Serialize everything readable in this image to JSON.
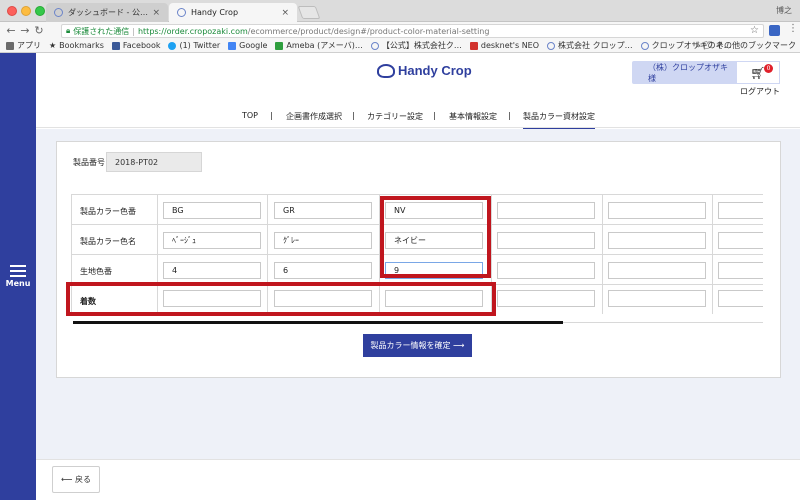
{
  "browser": {
    "tabs": [
      {
        "label": "ダッシュボード - 公式 | 株式会社",
        "active": false
      },
      {
        "label": "Handy Crop",
        "active": true
      }
    ],
    "profile_name": "博之",
    "secure_label": "保護された通信",
    "url_host": "https://order.cropozaki.com",
    "url_path": "/ecommerce/product/design#/product-color-material-setting",
    "bookmarks": [
      {
        "label": "アプリ",
        "icon": "apps-grid-icon"
      },
      {
        "label": "Bookmarks",
        "icon": "star-icon"
      },
      {
        "label": "Facebook",
        "icon": "facebook-icon"
      },
      {
        "label": "(1) Twitter",
        "icon": "twitter-icon"
      },
      {
        "label": "Google",
        "icon": "google-icon"
      },
      {
        "label": "Ameba (アメーバ)…",
        "icon": "ameba-icon"
      },
      {
        "label": "【公式】株式会社ク…",
        "icon": "globe-icon"
      },
      {
        "label": "desknet's NEO",
        "icon": "desknets-icon"
      },
      {
        "label": "株式会社 クロップ…",
        "icon": "globe-icon"
      },
      {
        "label": "クロップオザキのネ…",
        "icon": "globe-icon"
      }
    ],
    "other_bookmarks": "その他のブックマーク"
  },
  "rail": {
    "menu_label": "Menu"
  },
  "header": {
    "logo_text": "Handy Crop",
    "account_name": "（株）クロップオザキ 様",
    "cart_badge": "0",
    "logout_label": "ログアウト"
  },
  "nav": {
    "items": [
      "TOP",
      "企画書作成選択",
      "カテゴリー設定",
      "基本情報設定",
      "製品カラー資材設定"
    ],
    "active_index": 4
  },
  "form": {
    "product_number_label": "製品番号",
    "product_number_value": "2018-PT02",
    "rows": [
      {
        "label": "製品カラー色番",
        "values": [
          "BG",
          "GR",
          "NV",
          "",
          "",
          ""
        ]
      },
      {
        "label": "製品カラー色名",
        "values": [
          "ﾍﾞｰｼﾞｭ",
          "ｸﾞﾚｰ",
          "ネイビー",
          "",
          "",
          ""
        ]
      },
      {
        "label": "生地色番",
        "values": [
          "4",
          "6",
          "9",
          "",
          "",
          ""
        ]
      },
      {
        "label": "着数",
        "values": [
          "",
          "",
          "",
          "",
          "",
          ""
        ]
      }
    ],
    "confirm_button": "製品カラー情報を確定 ⟶",
    "back_button": "⟵ 戻る"
  },
  "colors": {
    "brand": "#2f3f9e",
    "highlight_border": "#c0161e",
    "content_bg": "#eef1f8"
  }
}
